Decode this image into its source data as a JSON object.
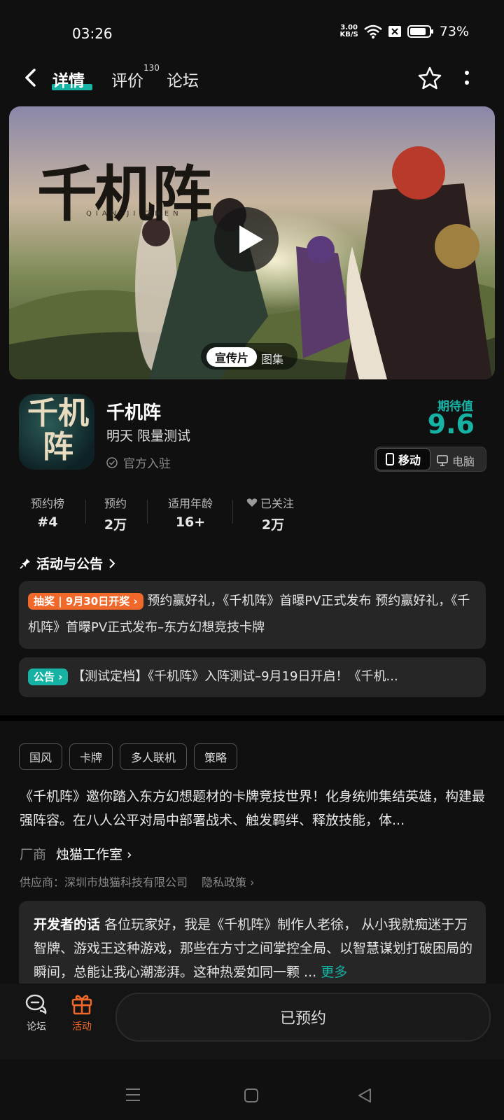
{
  "status": {
    "time": "03:26",
    "speed": "3.00",
    "speed_unit": "KB/S",
    "battery": "73%"
  },
  "nav": {
    "tabs": [
      {
        "label": "详情"
      },
      {
        "label": "评价"
      },
      {
        "label": "论坛"
      }
    ],
    "review_count": "130"
  },
  "banner": {
    "logo": "千机阵",
    "logo_sub": "QIAN JI ZHEN",
    "tabs": [
      "宣传片",
      "图集"
    ]
  },
  "app": {
    "icon_text": "千机阵",
    "name": "千机阵",
    "subtitle": "明天 限量测试",
    "official": "官方入驻",
    "score_label": "期待值",
    "score": "9.6",
    "platforms": [
      "移动",
      "电脑"
    ]
  },
  "stats": [
    {
      "label": "预约榜",
      "value": "#4"
    },
    {
      "label": "预约",
      "value": "2万"
    },
    {
      "label": "适用年龄",
      "value": "16+"
    },
    {
      "label": "已关注",
      "value": "2万"
    }
  ],
  "notices": {
    "title": "活动与公告",
    "items": [
      {
        "tag": "抽奖 | 9月30日开奖 ›",
        "text": "预约赢好礼，《千机阵》首曝PV正式发布 预约赢好礼，《千机阵》首曝PV正式发布–东方幻想竞技卡牌"
      },
      {
        "tag": "公告 ›",
        "text": "【测试定档】《千机阵》入阵测试–9月19日开启！《千机..."
      }
    ]
  },
  "tags": [
    "国风",
    "卡牌",
    "多人联机",
    "策略"
  ],
  "description": "《千机阵》邀你踏入东方幻想题材的卡牌竞技世界！化身统帅集结英雄，构建最强阵容。在八人公平对局中部署战术、触发羁绊、释放技能，体...",
  "vendor": {
    "label": "厂商",
    "name": "烛猫工作室 ›"
  },
  "supplier": {
    "text": "供应商：深圳市烛猫科技有限公司",
    "privacy": "隐私政策 ›"
  },
  "developer": {
    "label": "开发者的话",
    "text": "各位玩家好，我是《千机阵》制作人老徐， 从小我就痴迷于万智牌、游戏王这种游戏，那些在方寸之间掌控全局、以智慧谋划打破困局的瞬间，总能让我心潮澎湃。这种热爱如同一颗 ...",
    "more": "更多"
  },
  "bottom": {
    "forum": "论坛",
    "activity": "活动",
    "reserve": "已预约"
  },
  "colors": {
    "accent": "#16b2a4",
    "orange": "#f0692a",
    "bg": "#101010"
  }
}
